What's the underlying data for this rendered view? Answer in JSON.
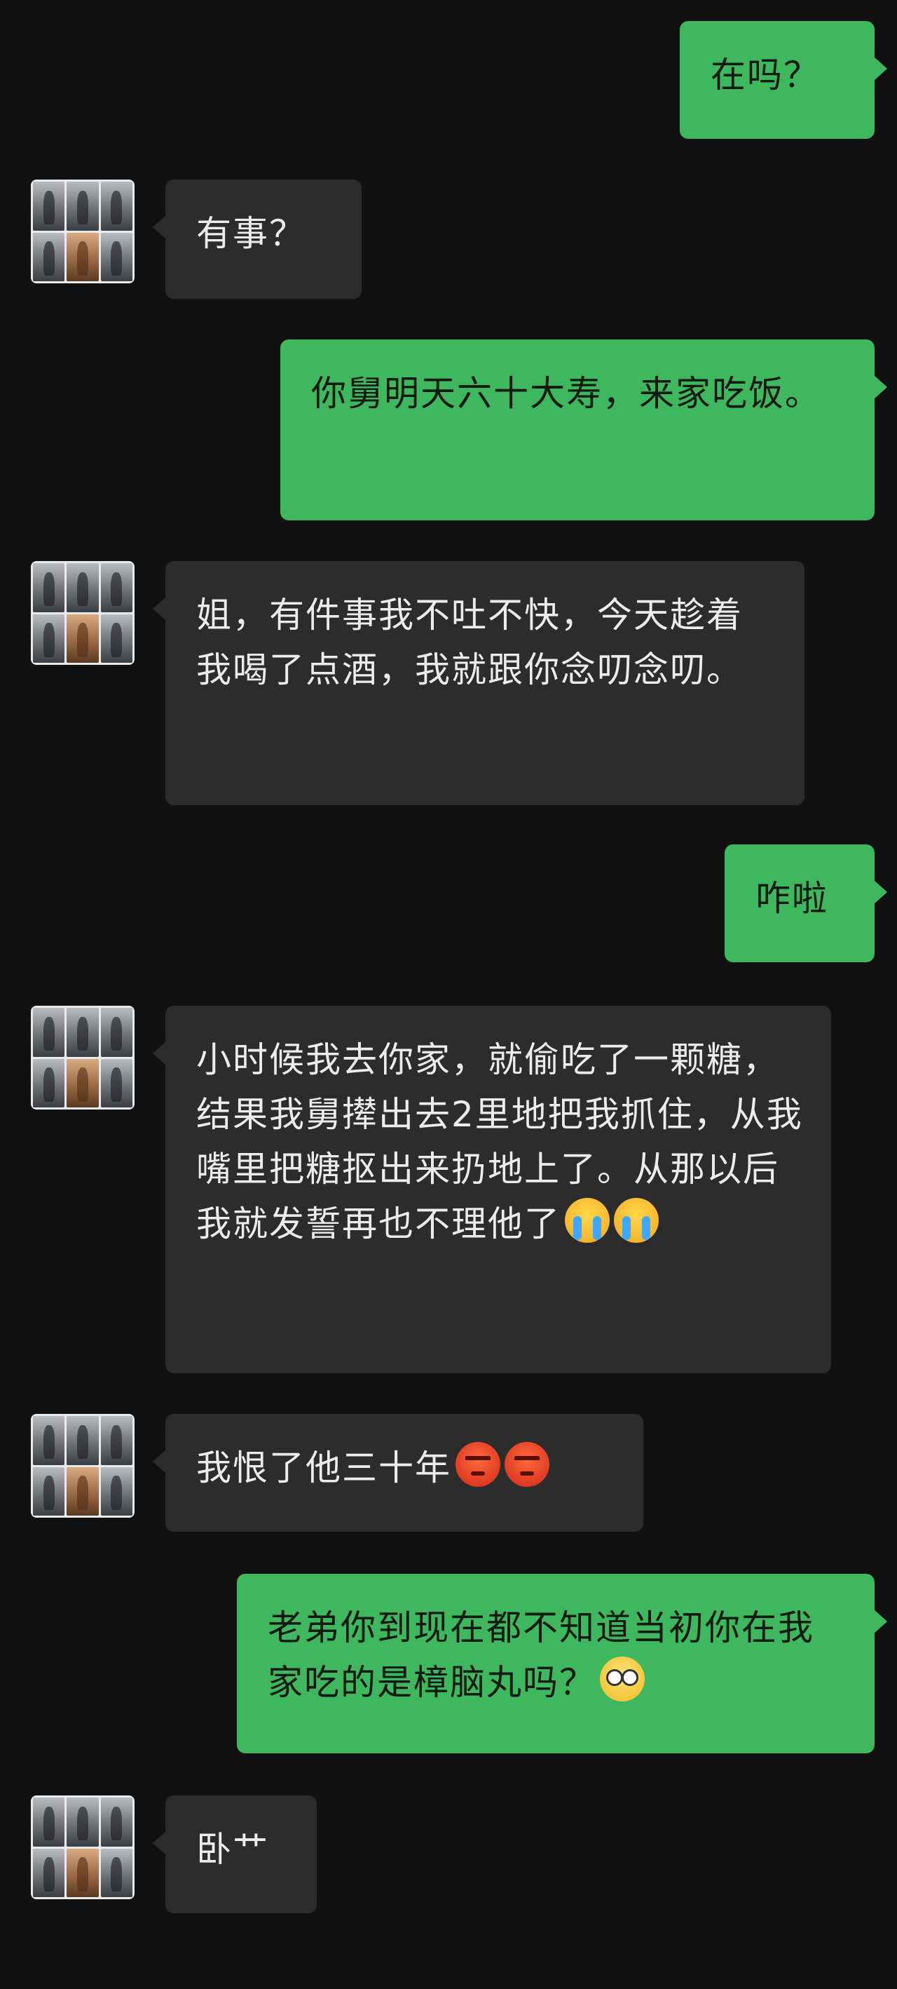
{
  "colors": {
    "background": "#111111",
    "incoming_bubble": "#2c2c2c",
    "outgoing_bubble": "#3eb75e",
    "incoming_text": "#ececec",
    "outgoing_text": "#0f1a10"
  },
  "messages": [
    {
      "from": "me",
      "text": "在吗？"
    },
    {
      "from": "them",
      "text": "有事？"
    },
    {
      "from": "me",
      "text": "你舅明天六十大寿，来家吃饭。"
    },
    {
      "from": "them",
      "text": "姐，有件事我不吐不快，今天趁着我喝了点酒，我就跟你念叨念叨。"
    },
    {
      "from": "me",
      "text": "咋啦"
    },
    {
      "from": "them",
      "text": "小时候我去你家，就偷吃了一颗糖，结果我舅撵出去2里地把我抓住，从我嘴里把糖抠出来扔地上了。从那以后我就发誓再也不理他了",
      "emoji": "loudly-crying-face-icon"
    },
    {
      "from": "them",
      "text": "我恨了他三十年",
      "emoji": "angry-face-icon"
    },
    {
      "from": "me",
      "text": "老弟你到现在都不知道当初你在我家吃的是樟脑丸吗？",
      "emoji": "flushed-face-icon"
    },
    {
      "from": "them",
      "text": "卧艹"
    }
  ]
}
